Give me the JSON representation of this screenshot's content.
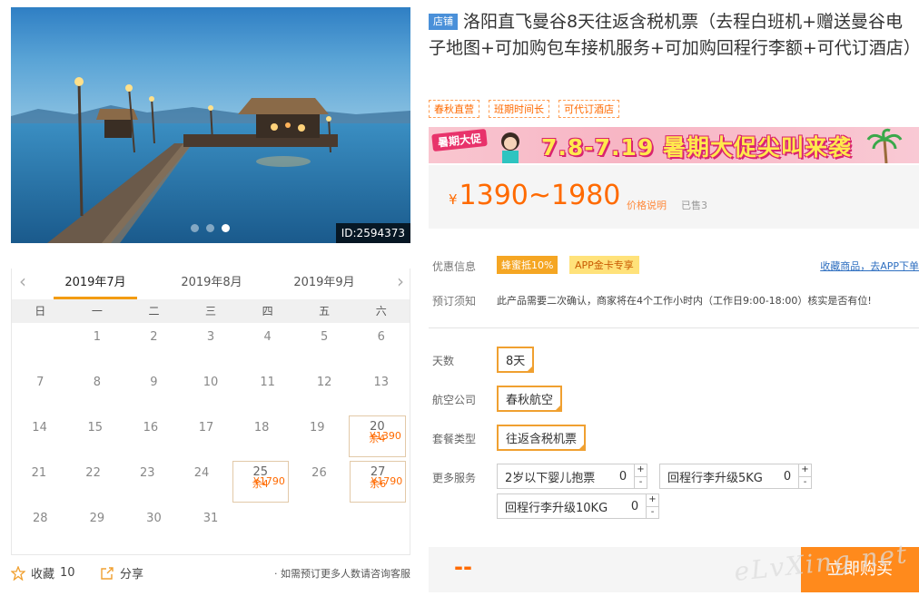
{
  "gallery": {
    "image_id": "ID:2594373",
    "slides": 3,
    "active_slide": 3
  },
  "calendar": {
    "months": [
      "2019年7月",
      "2019年8月",
      "2019年9月"
    ],
    "active_month": "2019年7月",
    "weekdays": [
      "日",
      "一",
      "二",
      "三",
      "四",
      "五",
      "六"
    ],
    "weeks": [
      [
        null,
        {
          "day": "1"
        },
        {
          "day": "2"
        },
        {
          "day": "3"
        },
        {
          "day": "4"
        },
        {
          "day": "5"
        },
        {
          "day": "6"
        }
      ],
      [
        {
          "day": "7"
        },
        {
          "day": "8"
        },
        {
          "day": "9"
        },
        {
          "day": "10"
        },
        {
          "day": "11"
        },
        {
          "day": "12"
        },
        {
          "day": "13"
        }
      ],
      [
        {
          "day": "14"
        },
        {
          "day": "15"
        },
        {
          "day": "16"
        },
        {
          "day": "17"
        },
        {
          "day": "18"
        },
        {
          "day": "19"
        },
        {
          "day": "20",
          "price": "¥1390",
          "stock": "余4"
        }
      ],
      [
        {
          "day": "21"
        },
        {
          "day": "22"
        },
        {
          "day": "23"
        },
        {
          "day": "24"
        },
        {
          "day": "25",
          "price": "¥1790",
          "stock": "余4"
        },
        {
          "day": "26"
        },
        {
          "day": "27",
          "price": "¥1790",
          "stock": "余6"
        }
      ],
      [
        {
          "day": "28"
        },
        {
          "day": "29"
        },
        {
          "day": "30"
        },
        {
          "day": "31"
        },
        null,
        null,
        null
      ]
    ]
  },
  "footer": {
    "fav_label": "收藏",
    "fav_count": "10",
    "share_label": "分享",
    "hint": "· 如需预订更多人数请咨询客服"
  },
  "product": {
    "shop_tag": "店铺",
    "title": "洛阳直飞曼谷8天往返含税机票（去程白班机+赠送曼谷电子地图+可加购包车接机服务+可加购回程行李额+可代订酒店）",
    "tags": [
      "春秋直营",
      "班期时间长",
      "可代订酒店"
    ]
  },
  "banner": {
    "badge": "暑期大促",
    "text": "7.8-7.19 暑期大促尖叫来袭"
  },
  "price": {
    "currency": "¥",
    "range": "1390~1980",
    "note": "价格说明",
    "sold": "已售3"
  },
  "promo": {
    "label": "优惠信息",
    "badge1": "蜂蜜抵10%",
    "badge2": "APP金卡专享",
    "collect_link": "收藏商品，去APP下单"
  },
  "notice": {
    "label": "预订须知",
    "text": "此产品需要二次确认，商家将在4个工作小时内（工作日9:00-18:00）核实是否有位!"
  },
  "options": {
    "days_label": "天数",
    "days_value": "8天",
    "airline_label": "航空公司",
    "airline_value": "春秋航空",
    "package_label": "套餐类型",
    "package_value": "往返含税机票",
    "services_label": "更多服务",
    "services": [
      {
        "name": "2岁以下婴儿抱票",
        "qty": "0"
      },
      {
        "name": "回程行李升级5KG",
        "qty": "0"
      },
      {
        "name": "回程行李升级10KG",
        "qty": "0"
      }
    ],
    "plus": "+",
    "minus": "-"
  },
  "buy": {
    "dash": "--",
    "button": "立即购买"
  },
  "watermark": "eLvXing.net",
  "colors": {
    "accent": "#ff6a00",
    "button": "#ff8a1c",
    "option_border": "#f0a030",
    "link": "#2f6fc0"
  }
}
